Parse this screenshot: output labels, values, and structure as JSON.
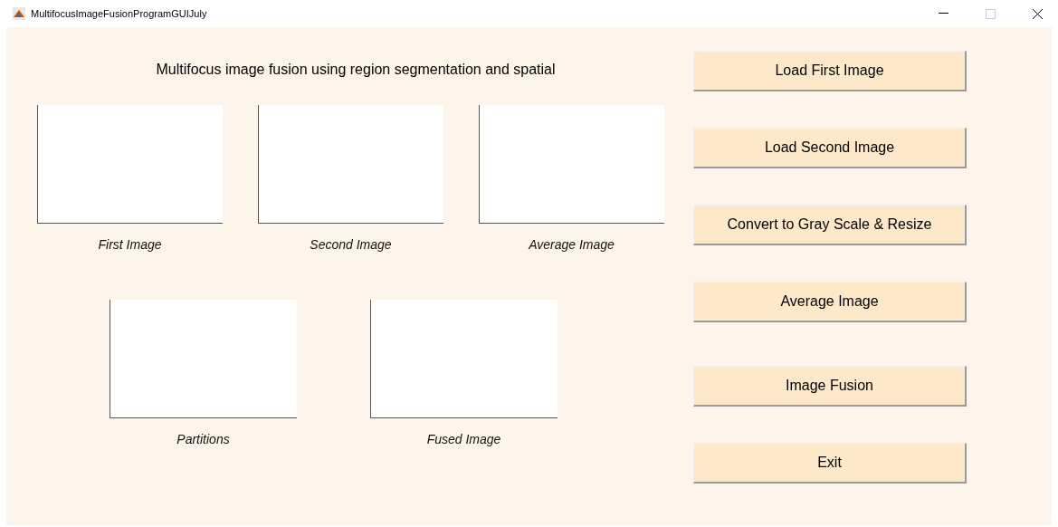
{
  "window": {
    "title": "MultifocusImageFusionProgramGUIJuly"
  },
  "heading": "Multifocus image fusion using region segmentation and spatial",
  "axes_rows": [
    [
      {
        "caption": "First Image"
      },
      {
        "caption": "Second Image"
      },
      {
        "caption": "Average Image"
      }
    ],
    [
      {
        "caption": "Partitions"
      },
      {
        "caption": "Fused Image"
      }
    ]
  ],
  "buttons": [
    "Load First Image",
    "Load Second Image",
    "Convert to Gray Scale & Resize",
    "Average Image",
    "Image Fusion",
    "Exit"
  ]
}
